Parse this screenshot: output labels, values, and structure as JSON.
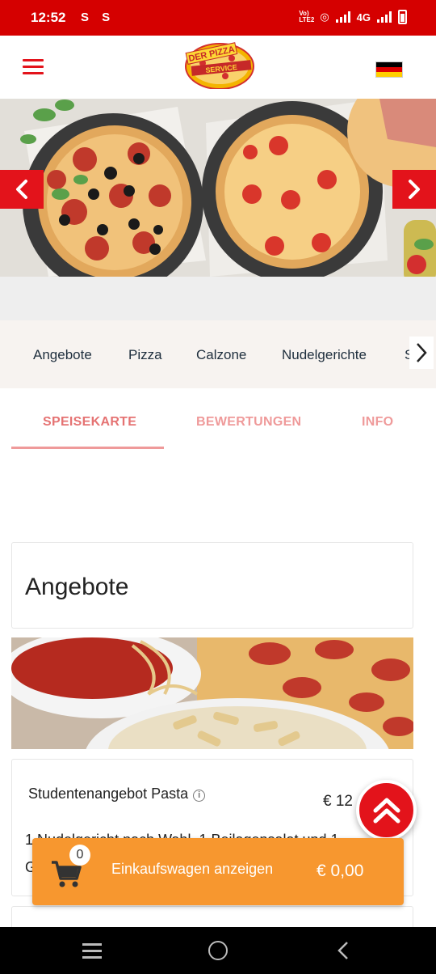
{
  "status_bar": {
    "time": "12:52",
    "left_icons": "S S",
    "carrier": "Vo) LTE2",
    "network": "4G"
  },
  "header": {
    "logo_text_top": "DER PIZZA",
    "logo_text_bottom": "SERVICE",
    "menu_icon": "hamburger-icon",
    "language_flag": "germany-flag-icon"
  },
  "carousel": {
    "prev_icon": "chevron-left-icon",
    "next_icon": "chevron-right-icon"
  },
  "categories": {
    "items": [
      "Angebote",
      "Pizza",
      "Calzone",
      "Nudelgerichte",
      "S"
    ],
    "more_icon": "chevron-right-icon"
  },
  "tabs": {
    "items": [
      "SPEISEKARTE",
      "BEWERTUNGEN",
      "INFO"
    ],
    "active_index": 0
  },
  "menu": {
    "section_title": "Angebote",
    "items": [
      {
        "name": "Studentenangebot Pasta",
        "price": "€ 12",
        "description_line1": "1 Nudelgericht nach Wahl, 1 Beilagensalat und 1",
        "description_line2": "G"
      }
    ]
  },
  "cart": {
    "count": "0",
    "label": "Einkaufswagen anzeigen",
    "total": "€ 0,00"
  },
  "colors": {
    "brand_red": "#e3131b",
    "status_red": "#d50000",
    "tab_text": "#ef9a9a",
    "cart_orange": "#f7972f"
  }
}
